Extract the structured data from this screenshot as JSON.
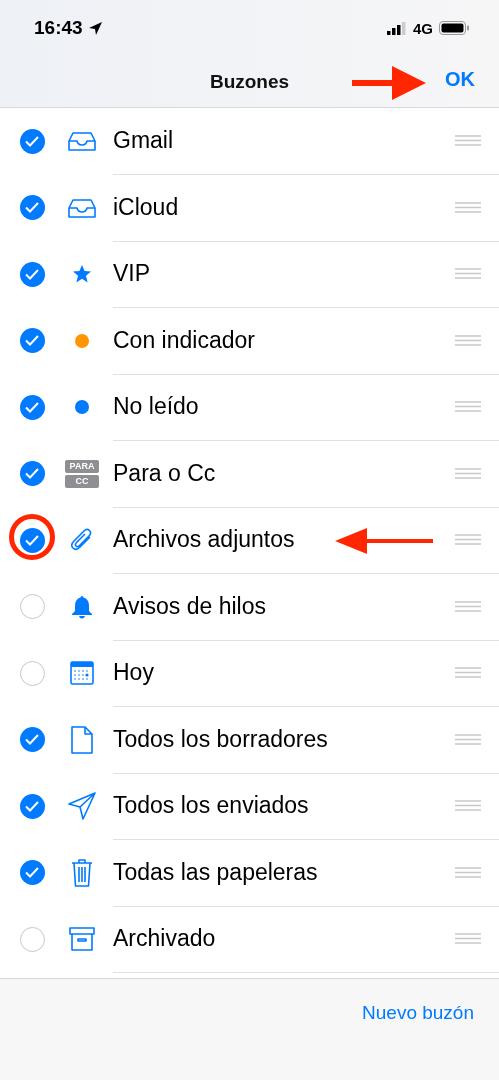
{
  "status_bar": {
    "time": "16:43",
    "network": "4G"
  },
  "nav": {
    "title": "Buzones",
    "done": "OK",
    "annotated": true
  },
  "mailboxes": [
    {
      "label": "Gmail",
      "kind": "inbox",
      "checked": true,
      "annotated": false
    },
    {
      "label": "iCloud",
      "kind": "inbox",
      "checked": true,
      "annotated": false
    },
    {
      "label": "VIP",
      "kind": "star",
      "checked": true,
      "annotated": false
    },
    {
      "label": "Con indicador",
      "kind": "dot",
      "color": "#ff9500",
      "checked": true,
      "annotated": false
    },
    {
      "label": "No leído",
      "kind": "dot",
      "color": "#007aff",
      "checked": true,
      "annotated": false
    },
    {
      "label": "Para o Cc",
      "kind": "tag",
      "tag_lines": [
        "PARA",
        "CC"
      ],
      "checked": true,
      "annotated": false
    },
    {
      "label": "Archivos adjuntos",
      "kind": "paperclip",
      "checked": true,
      "annotated": true
    },
    {
      "label": "Avisos de hilos",
      "kind": "bell",
      "checked": false,
      "annotated": false
    },
    {
      "label": "Hoy",
      "kind": "calendar",
      "checked": false,
      "annotated": false
    },
    {
      "label": "Todos los borradores",
      "kind": "document",
      "checked": true,
      "annotated": false
    },
    {
      "label": "Todos los enviados",
      "kind": "send",
      "checked": true,
      "annotated": false
    },
    {
      "label": "Todas las papeleras",
      "kind": "trash",
      "checked": true,
      "annotated": false
    },
    {
      "label": "Archivado",
      "kind": "archive",
      "checked": false,
      "annotated": false
    }
  ],
  "toolbar": {
    "new_mailbox": "Nuevo buzón"
  }
}
